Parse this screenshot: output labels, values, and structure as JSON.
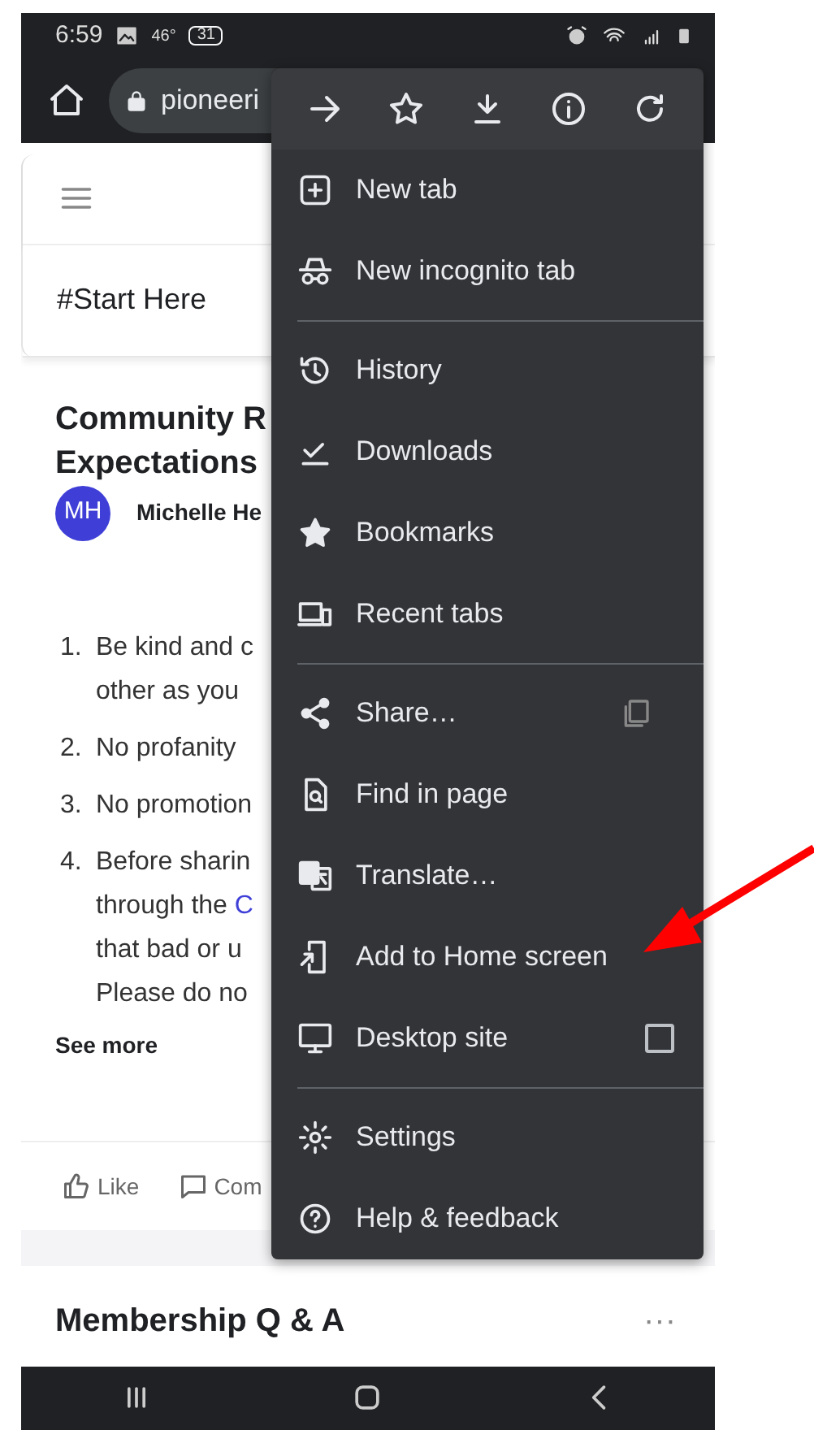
{
  "status_bar": {
    "time": "6:59",
    "temperature": "46°",
    "calendar_day": "31"
  },
  "address_bar": {
    "url": "pioneeri"
  },
  "page": {
    "channel": "#Start Here",
    "post": {
      "title_lines": [
        "Community R",
        "Expectations"
      ],
      "avatar_initials": "MH",
      "author": "Michelle He",
      "rules": [
        {
          "number": "1.",
          "lines": [
            {
              "text": "Be kind and c"
            },
            {
              "text": "other as you"
            }
          ]
        },
        {
          "number": "2.",
          "lines": [
            {
              "text": "No profanity"
            }
          ]
        },
        {
          "number": "3.",
          "lines": [
            {
              "text": "No promotion"
            }
          ]
        },
        {
          "number": "4.",
          "lines": [
            {
              "text": "Before sharin"
            },
            {
              "text": "through the",
              "link": "C"
            },
            {
              "text": "that bad or u"
            },
            {
              "text": "Please do no"
            }
          ]
        }
      ],
      "see_more": "See more",
      "actions": [
        {
          "label": "Like",
          "kind": "like"
        },
        {
          "label": "Com",
          "kind": "comment"
        }
      ]
    },
    "next_section": {
      "title": "Membership Q & A",
      "more": "···"
    }
  },
  "menu": {
    "groups": [
      [
        {
          "label": "New tab",
          "kind": "plain"
        },
        {
          "label": "New incognito tab",
          "kind": "plain"
        }
      ],
      [
        {
          "label": "History",
          "kind": "plain"
        },
        {
          "label": "Downloads",
          "kind": "plain"
        },
        {
          "label": "Bookmarks",
          "kind": "plain"
        },
        {
          "label": "Recent tabs",
          "kind": "plain"
        }
      ],
      [
        {
          "label": "Share…",
          "kind": "share"
        },
        {
          "label": "Find in page",
          "kind": "plain"
        },
        {
          "label": "Translate…",
          "kind": "plain"
        },
        {
          "label": "Add to Home screen",
          "kind": "plain"
        },
        {
          "label": "Desktop site",
          "kind": "checkbox",
          "checked": false
        }
      ],
      [
        {
          "label": "Settings",
          "kind": "plain"
        },
        {
          "label": "Help & feedback",
          "kind": "plain"
        }
      ]
    ]
  }
}
